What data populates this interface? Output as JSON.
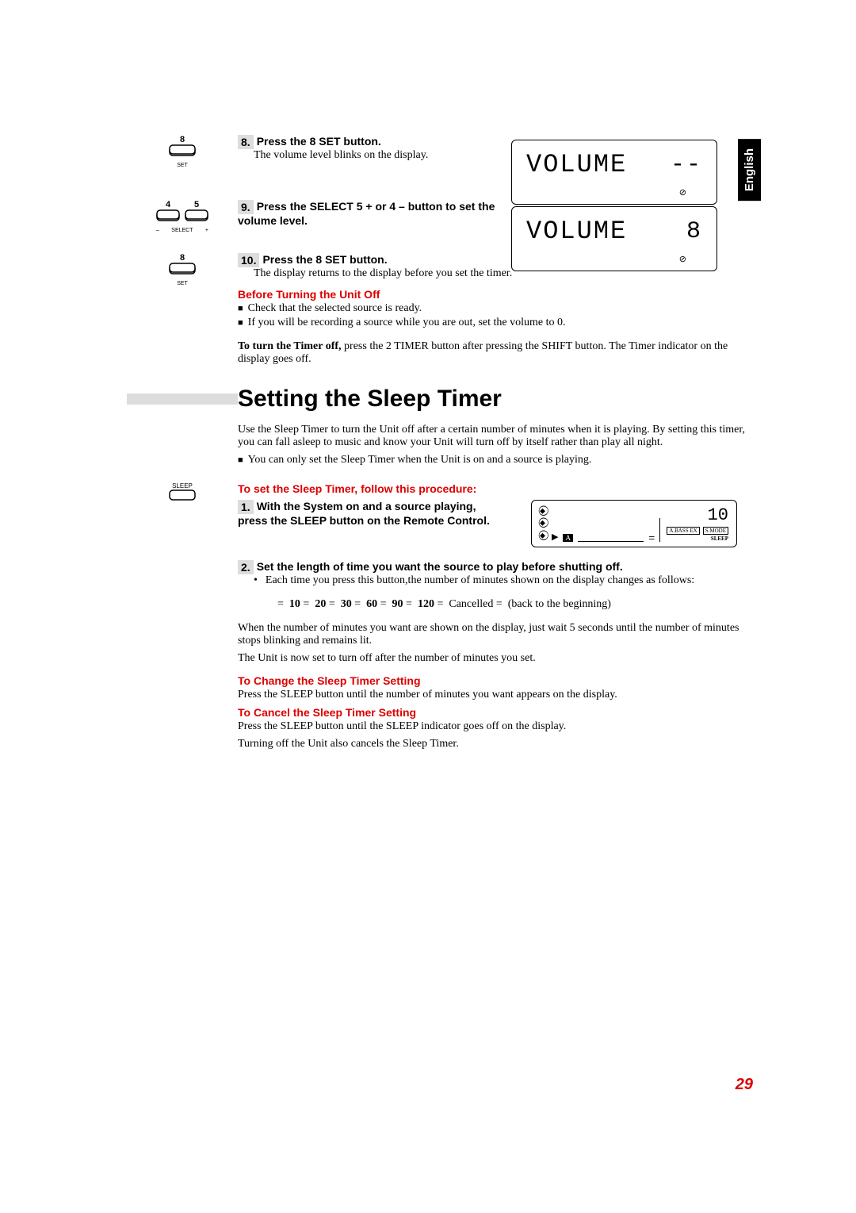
{
  "lang": "English",
  "step8": {
    "num": "8.",
    "title": "Press the 8 SET button.",
    "body": "The volume level blinks on the display.",
    "icon_num": "8",
    "icon_label": "SET"
  },
  "display1": {
    "label": "VOLUME",
    "val": "--"
  },
  "step9": {
    "num": "9.",
    "title": "Press the SELECT 5 + or 4 – button to set the volume level.",
    "icon_l_num": "4",
    "icon_r_num": "5",
    "icon_label_l_minus": "–",
    "icon_label_select": "SELECT",
    "icon_label_r_plus": "+"
  },
  "display2": {
    "label": "VOLUME",
    "val": "8"
  },
  "step10": {
    "num": "10.",
    "title": "Press the 8 SET button.",
    "body": "The display returns to the display before you set the timer.",
    "icon_num": "8",
    "icon_label": "SET"
  },
  "before_off": {
    "head": "Before Turning the Unit Off",
    "b1": "Check that the selected source is ready.",
    "b2": "If you will be recording a source while you are out, set the volume to 0."
  },
  "turn_off": {
    "prefix": "To turn the Timer off,",
    "body": " press the 2 TIMER button after pressing the SHIFT button. The Timer indicator on the display goes off."
  },
  "h1": "Setting the Sleep Timer",
  "intro": {
    "p": "Use the Sleep Timer to turn the Unit off after a certain number of minutes when it is playing. By setting this timer, you can fall asleep to music and know your Unit will turn off by itself rather than play all night.",
    "b1": "You can only set the Sleep Timer when the Unit is on and a source is playing."
  },
  "sleep_icon_label": "SLEEP",
  "proc_head": "To set the Sleep Timer, follow this procedure:",
  "sstep1": {
    "num": "1.",
    "title": "With the System on and a source playing, press the SLEEP button on the Remote Control."
  },
  "sleep_display": {
    "num": "10",
    "tag1": "A.BASS EX",
    "tag2": "S.MODE",
    "sleep": "SLEEP",
    "play": "▶",
    "box": "A"
  },
  "sstep2": {
    "num": "2.",
    "title": "Set the length of time you want the source to play before shutting off.",
    "dot": "Each time you press this button,the number of minutes shown on the display changes as follows:"
  },
  "seq": {
    "arrow": "=",
    "v1": "10",
    "v2": "20",
    "v3": "30",
    "v4": "60",
    "v5": "90",
    "v6": "120",
    "cancel": "Cancelled",
    "back": "(back to the beginning)"
  },
  "wait": {
    "p1": "When the number of minutes you want are shown on the display, just wait 5 seconds until the number of minutes stops blinking and remains lit.",
    "p2": "The Unit is now set to turn off after the number of minutes you set."
  },
  "change": {
    "head": "To Change the Sleep Timer Setting",
    "body": "Press the SLEEP button until the number of minutes you want appears on the display."
  },
  "cancel": {
    "head": "To Cancel the Sleep Timer Setting",
    "body1": "Press the SLEEP button until the SLEEP indicator goes off on the display.",
    "body2": "Turning off the Unit also cancels the Sleep Timer."
  },
  "page_num": "29"
}
